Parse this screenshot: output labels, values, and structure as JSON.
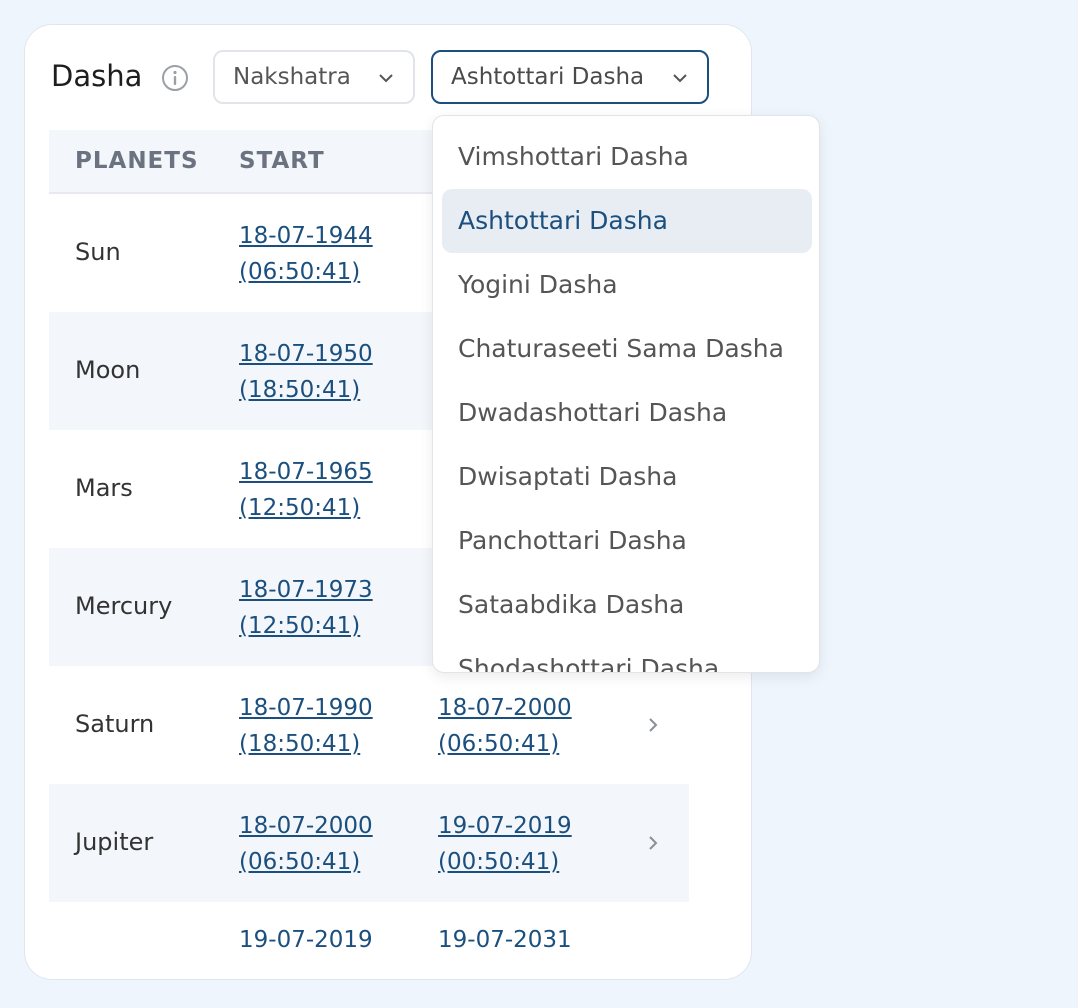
{
  "header": {
    "title": "Dasha",
    "system_select": "Nakshatra",
    "dasha_select": "Ashtottari Dasha"
  },
  "table": {
    "columns": [
      "PLANETS",
      "START"
    ],
    "rows": [
      {
        "planet": "Sun",
        "start_date": "18-07-1944",
        "start_time": "(06:50:41)",
        "end_date": "",
        "end_time": ""
      },
      {
        "planet": "Moon",
        "start_date": "18-07-1950",
        "start_time": "(18:50:41)",
        "end_date": "",
        "end_time": ""
      },
      {
        "planet": "Mars",
        "start_date": "18-07-1965",
        "start_time": "(12:50:41)",
        "end_date": "",
        "end_time": ""
      },
      {
        "planet": "Mercury",
        "start_date": "18-07-1973",
        "start_time": "(12:50:41)",
        "end_date": "",
        "end_time": ""
      },
      {
        "planet": "Saturn",
        "start_date": "18-07-1990",
        "start_time": "(18:50:41)",
        "end_date": "18-07-2000",
        "end_time": "(06:50:41)"
      },
      {
        "planet": "Jupiter",
        "start_date": "18-07-2000",
        "start_time": "(06:50:41)",
        "end_date": "19-07-2019",
        "end_time": "(00:50:41)"
      },
      {
        "planet": "",
        "start_date": "19-07-2019",
        "start_time": "",
        "end_date": "19-07-2031",
        "end_time": ""
      }
    ]
  },
  "dropdown": {
    "options": [
      "Vimshottari Dasha",
      "Ashtottari Dasha",
      "Yogini Dasha",
      "Chaturaseeti Sama Dasha",
      "Dwadashottari Dasha",
      "Dwisaptati Dasha",
      "Panchottari Dasha",
      "Sataabdika Dasha",
      "Shodashottari Dasha"
    ],
    "selected": "Ashtottari Dasha"
  },
  "colors": {
    "accent": "#1b4f7e",
    "background": "#eff5fd",
    "row_alt": "#f3f6fa"
  },
  "icons": {
    "info": "info-icon",
    "chevron": "chevron-down-icon",
    "row_arrow": "chevron-right-icon"
  }
}
